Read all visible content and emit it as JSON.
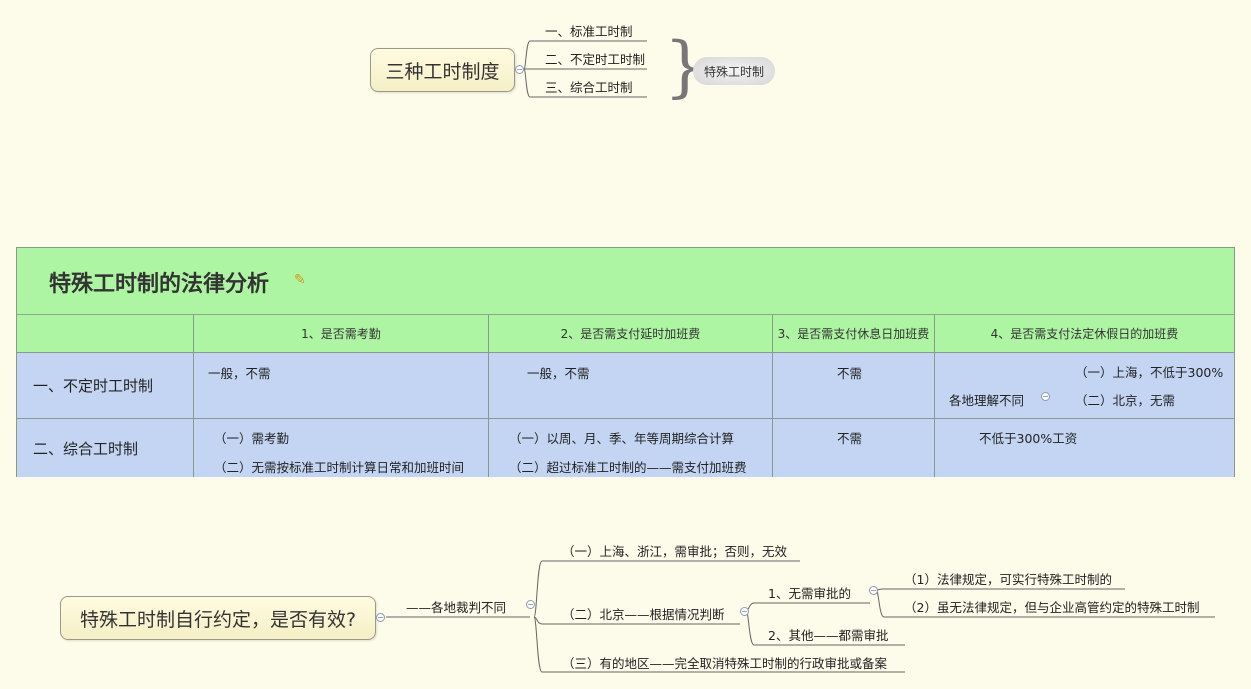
{
  "mindmap1": {
    "root": "三种工时制度",
    "branches": [
      "一、标准工时制",
      "二、不定时工时制",
      "三、综合工时制"
    ],
    "summary": "特殊工时制"
  },
  "matrix": {
    "title": "特殊工时制的法律分析",
    "headers": [
      "1、是否需考勤",
      "2、是否需支付延时加班费",
      "3、是否需支付休息日加班费",
      "4、是否需支付法定休假日的加班费"
    ],
    "rows": [
      {
        "label": "一、不定时工时制",
        "c1": [
          "一般，不需"
        ],
        "c2": [
          "一般，不需"
        ],
        "c3": [
          "不需"
        ],
        "c4": {
          "text": "各地理解不同",
          "subs": [
            "（一）上海，不低于300%",
            "（二）北京，无需"
          ]
        }
      },
      {
        "label": "二、综合工时制",
        "c1": [
          "（一）需考勤",
          "（二）无需按标准工时制计算日常和加班时间"
        ],
        "c2": [
          "（一）以周、月、季、年等周期综合计算",
          "（二）超过标准工时制的——需支付加班费"
        ],
        "c3": [
          "不需"
        ],
        "c4": {
          "text": "不低于300%工资"
        }
      }
    ]
  },
  "mindmap2": {
    "root": "特殊工时制自行约定，是否有效?",
    "mid": "——各地裁判不同",
    "b1": "（一）上海、浙江，需审批；否则，无效",
    "b2": "（二）北京——根据情况判断",
    "b2a": "1、无需审批的",
    "b2a1": "（1）法律规定，可实行特殊工时制的",
    "b2a2": "（2）虽无法律规定，但与企业高管约定的特殊工时制",
    "b2b": "2、其他——都需审批",
    "b3": "（三）有的地区——完全取消特殊工时制的行政审批或备案"
  },
  "colors": {
    "background": "#fdfbea",
    "header_green": "#adf5a2",
    "body_blue": "#c3d5f2",
    "branch_blue": "#4a7bb5"
  },
  "icons": [
    "collapse-icon",
    "note-icon",
    "brace-icon"
  ]
}
